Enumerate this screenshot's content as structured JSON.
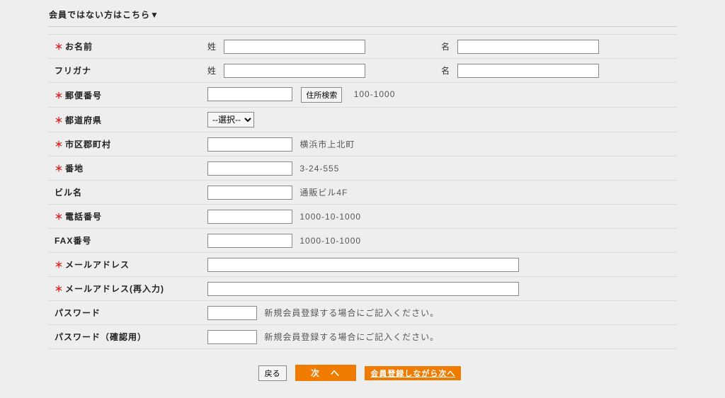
{
  "header": {
    "toggle": "会員ではない方はこちら▼"
  },
  "labels": {
    "name": "お名前",
    "kana": "フリガナ",
    "zip": "郵便番号",
    "pref": "都道府県",
    "city": "市区郡町村",
    "addr": "番地",
    "bldg": "ビル名",
    "tel": "電話番号",
    "fax": "FAX番号",
    "email": "メールアドレス",
    "email2": "メールアドレス(再入力)",
    "pw": "パスワード",
    "pw2": "パスワード（確認用）",
    "sei": "姓",
    "mei": "名"
  },
  "required_mark": "＊",
  "zip": {
    "search_btn": "住所検索",
    "example": "100-1000"
  },
  "pref_placeholder": "--選択--",
  "examples": {
    "city": "横浜市上北町",
    "addr": "3-24-555",
    "bldg": "通販ビル4F",
    "tel": "1000-10-1000",
    "fax": "1000-10-1000"
  },
  "pw_hint": "新規会員登録する場合にご記入ください。",
  "actions": {
    "back": "戻る",
    "next": "次　へ",
    "register_next": "会員登録しながら次へ"
  }
}
